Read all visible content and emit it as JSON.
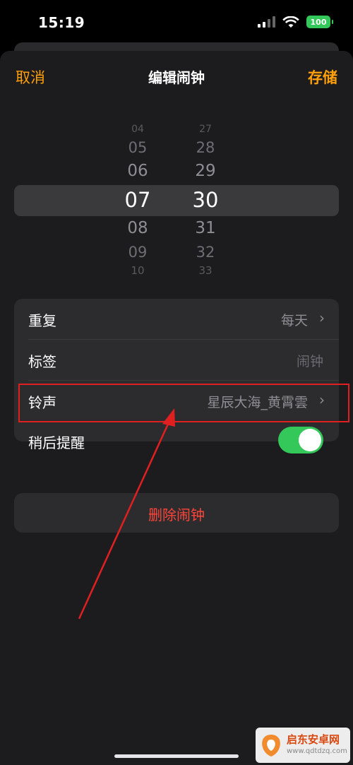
{
  "status_bar": {
    "time": "15:19",
    "battery": "100"
  },
  "nav": {
    "cancel": "取消",
    "title": "编辑闹钟",
    "save": "存储"
  },
  "picker": {
    "hours": [
      "04",
      "05",
      "06",
      "07",
      "08",
      "09",
      "10"
    ],
    "minutes": [
      "27",
      "28",
      "29",
      "30",
      "31",
      "32",
      "33"
    ],
    "selected_hour": "07",
    "selected_minute": "30"
  },
  "settings": {
    "repeat": {
      "label": "重复",
      "value": "每天"
    },
    "label": {
      "label": "标签",
      "placeholder": "闹钟"
    },
    "sound": {
      "label": "铃声",
      "value": "星辰大海_黄霄雲"
    },
    "snooze": {
      "label": "稍后提醒",
      "on": true
    }
  },
  "delete_label": "删除闹钟",
  "annotation_color": "#e02020",
  "accent_color": "#ff9f0a",
  "watermark": {
    "title": "启东安卓网",
    "url": "www.qdtdzq.com"
  }
}
